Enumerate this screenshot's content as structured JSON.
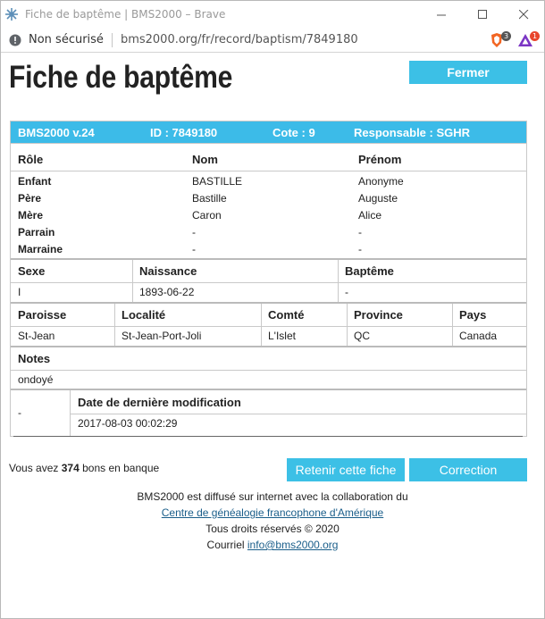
{
  "browser": {
    "window_title": "Fiche de baptême | BMS2000 – Brave",
    "security_label": "Non sécurisé",
    "url": "bms2000.org/fr/record/baptism/7849180",
    "shields_count": "3",
    "rewards_count": "1"
  },
  "page": {
    "title": "Fiche de baptême",
    "close_button": "Fermer"
  },
  "record": {
    "header": {
      "version": "BMS2000 v.24",
      "id": "ID : 7849180",
      "cote": "Cote : 9",
      "responsable": "Responsable : SGHR"
    },
    "people_headers": [
      "Rôle",
      "Nom",
      "Prénom"
    ],
    "people": [
      {
        "role": "Enfant",
        "nom": "BASTILLE",
        "prenom": "Anonyme"
      },
      {
        "role": "Père",
        "nom": "Bastille",
        "prenom": "Auguste"
      },
      {
        "role": "Mère",
        "nom": "Caron",
        "prenom": "Alice"
      },
      {
        "role": "Parrain",
        "nom": "-",
        "prenom": "-"
      },
      {
        "role": "Marraine",
        "nom": "-",
        "prenom": "-"
      }
    ],
    "event_headers": [
      "Sexe",
      "Naissance",
      "Baptême"
    ],
    "event": {
      "sexe": "I",
      "naissance": "1893-06-22",
      "bapteme": "-"
    },
    "place_headers": [
      "Paroisse",
      "Localité",
      "Comté",
      "Province",
      "Pays"
    ],
    "place": {
      "paroisse": "St-Jean",
      "localite": "St-Jean-Port-Joli",
      "comte": "L'Islet",
      "province": "QC",
      "pays": "Canada"
    },
    "notes_header": "Notes",
    "notes": "ondoyé",
    "modif_left": "-",
    "modif_header": "Date de dernière modification",
    "modif_date": "2017-08-03 00:02:29"
  },
  "bank": {
    "prefix": "Vous avez",
    "count": "374",
    "suffix": "bons en banque"
  },
  "actions": {
    "retain": "Retenir cette fiche",
    "correction": "Correction"
  },
  "footer": {
    "line1": "BMS2000 est diffusé sur internet avec la collaboration du",
    "link1": "Centre de généalogie francophone d'Amérique",
    "line3": "Tous droits réservés © 2020",
    "email_prefix": "Courriel",
    "email": "info@bms2000.org"
  },
  "colors": {
    "accent": "#3cc0e6",
    "link": "#1a5e8a"
  }
}
